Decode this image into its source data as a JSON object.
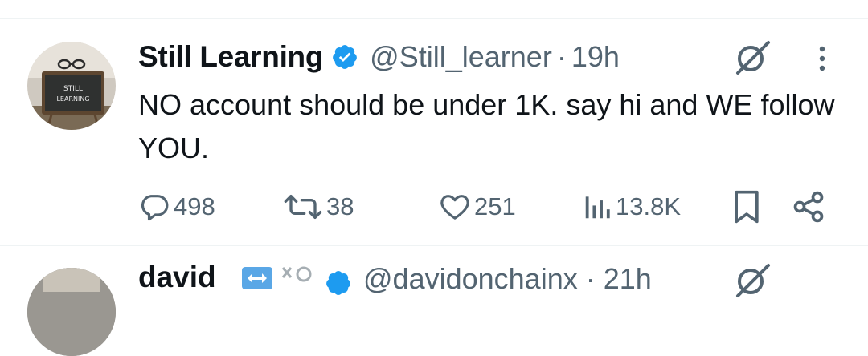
{
  "tweet": {
    "author_name": "Still Learning",
    "handle": "@Still_learner",
    "separator": "·",
    "time": "19h",
    "avatar_text_line1": "STILL",
    "avatar_text_line2": "LEARNING",
    "text": "NO account should be under 1K. say hi and WE follow YOU.",
    "actions": {
      "replies": "498",
      "reposts": "38",
      "likes": "251",
      "views": "13.8K"
    },
    "verified_color": "#1d9bf0"
  },
  "next_tweet": {
    "author_name": "david",
    "handle": "@davidonchainx · 21h"
  },
  "colors": {
    "text": "#0f1419",
    "secondary": "#536471",
    "divider": "#eff3f4"
  }
}
